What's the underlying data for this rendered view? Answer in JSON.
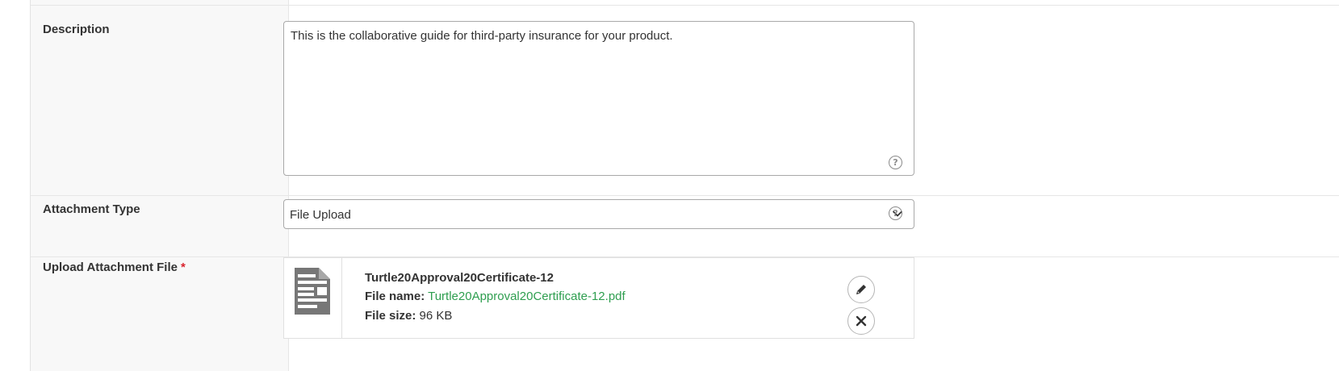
{
  "fields": {
    "description": {
      "label": "Description",
      "value": "This is the collaborative guide for third-party insurance for your product.",
      "help_icon": "question-circle-icon"
    },
    "attachment_type": {
      "label": "Attachment Type",
      "selected": "File Upload",
      "dropdown_icon": "chevron-down-icon",
      "help_icon": "question-circle-icon"
    },
    "upload": {
      "label": "Upload Attachment File",
      "required_mark": "*",
      "file": {
        "title": "Turtle20Approval20Certificate-12",
        "name_label": "File name:",
        "name": "Turtle20Approval20Certificate-12.pdf",
        "size_label": "File size:",
        "size": "96 KB",
        "thumbnail_icon": "document-icon"
      },
      "edit_icon": "pencil-icon",
      "remove_icon": "close-icon"
    }
  },
  "help_glyph": "?",
  "colors": {
    "required": "#d9232d",
    "link": "#2e9e4f",
    "label_bg": "#f8f8f8",
    "border": "#a9a9a9"
  }
}
